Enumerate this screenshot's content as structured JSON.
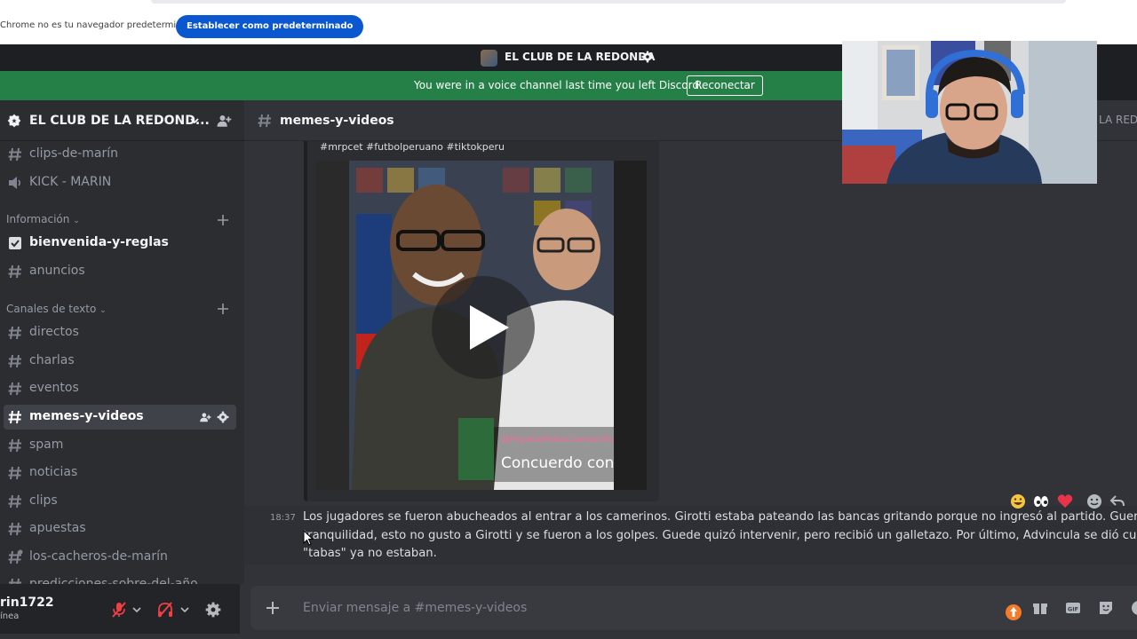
{
  "browser_bar": {
    "message": "Chrome no es tu navegador predeterminado",
    "set_default_label": "Establecer como predeterminado"
  },
  "title_bar": {
    "server_title": "EL CLUB DE LA REDONDA"
  },
  "voice_notice": {
    "message": "You were in a voice channel last time you left Discord.",
    "reconnect_label": "Reconectar"
  },
  "server": {
    "name": "EL CLUB DE LA REDOND..."
  },
  "channels_top": [
    {
      "name": "clips-de-marín",
      "icon": "hash-icon"
    },
    {
      "name": "KICK - MARIN",
      "icon": "speaker-icon"
    }
  ],
  "categories": {
    "informacion": "Información",
    "texto": "Canales de texto"
  },
  "channels_info": [
    {
      "name": "bienvenida-y-reglas",
      "icon": "rules-icon"
    },
    {
      "name": "anuncios",
      "icon": "hash-icon"
    }
  ],
  "channels_text": [
    {
      "name": "directos"
    },
    {
      "name": "charlas"
    },
    {
      "name": "eventos"
    },
    {
      "name": "memes-y-videos"
    },
    {
      "name": "spam"
    },
    {
      "name": "noticias"
    },
    {
      "name": "clips"
    },
    {
      "name": "apuestas"
    },
    {
      "name": "los-cacheros-de-marín"
    },
    {
      "name": "predicciones-sobre-del-año"
    }
  ],
  "user": {
    "name": "rin1722",
    "status": "ínea"
  },
  "channel_header": {
    "name": "memes-y-videos",
    "right_text": "LA REDO"
  },
  "embed": {
    "hashtags": "#mrpcet #futbolperuano #tiktokperu",
    "video_handle": "@PepaDePaltaCuentaOfic",
    "video_caption": "Concuerdo con"
  },
  "message": {
    "time": "18:37",
    "lines": [
      "Los jugadores se fueron abucheados al entrar a los camerinos. Girotti estaba pateando las bancas gritando porque no ingresó al partido. Guerrero le p",
      "tranquilidad, esto no gusto a Girotti y se fueron a los golpes. Guede quizó intervenir, pero recibió un galletazo. Por último, Advincula se dió cuenta que",
      "\"tabas\" ya no estaban."
    ]
  },
  "composer": {
    "placeholder": "Enviar mensaje a #memes-y-videos"
  },
  "colors": {
    "accent_blue": "#0b57d0",
    "notice_green": "#248046",
    "sidebar_bg": "#2b2d31",
    "main_bg": "#313338"
  }
}
